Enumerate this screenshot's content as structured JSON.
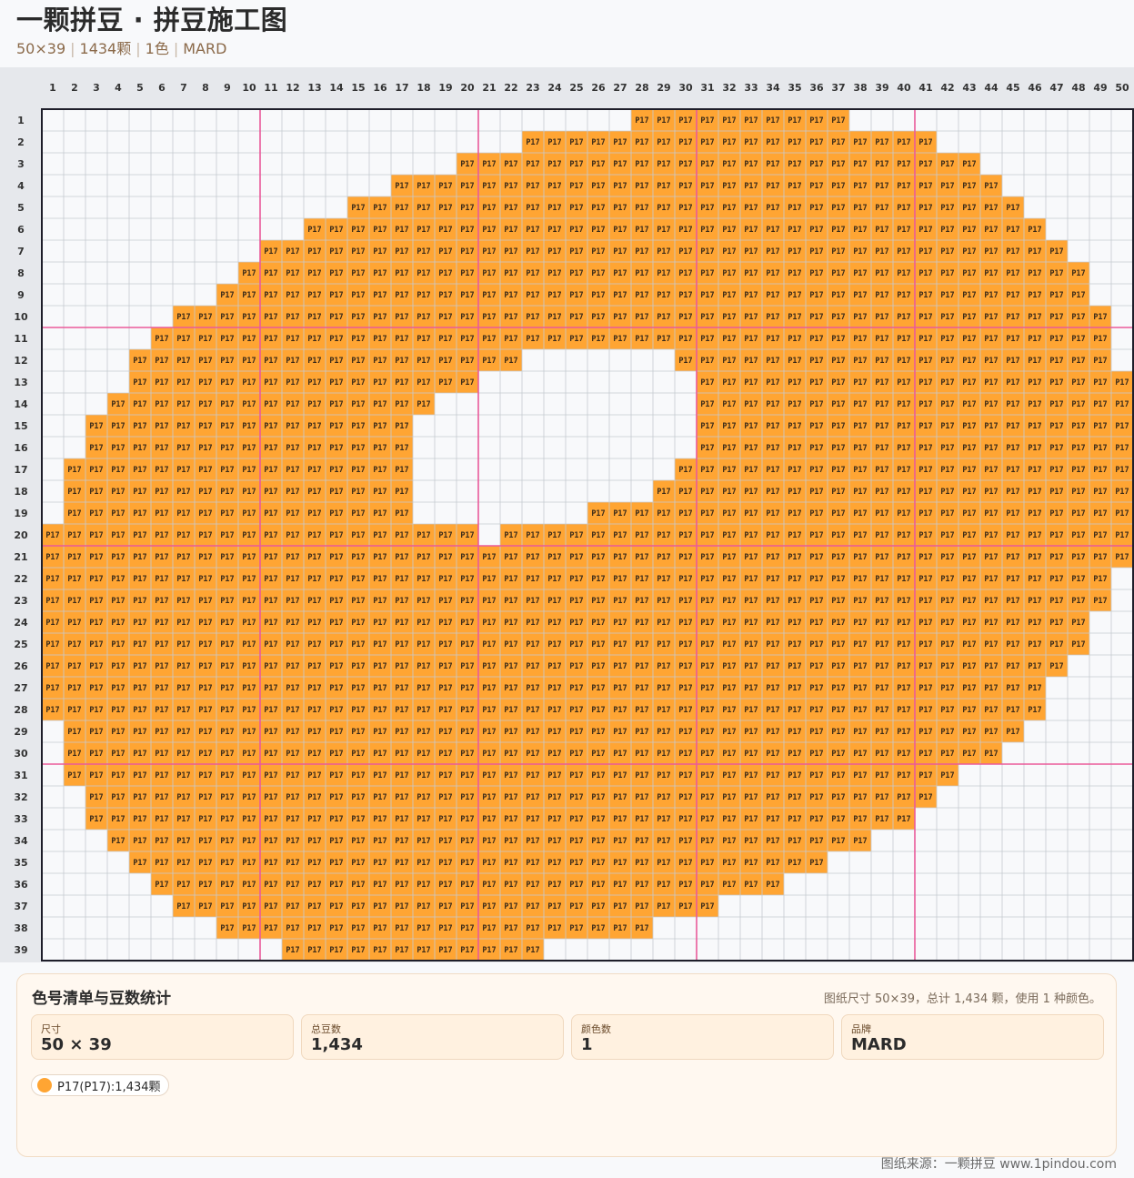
{
  "header": {
    "title": "一颗拼豆 · 拼豆施工图",
    "size": "50×39",
    "count": "1434颗",
    "colors": "1色",
    "brand": "MARD"
  },
  "grid": {
    "columns": 50,
    "rows": 39,
    "bead_code": "P17",
    "bead_color": "#ffa533",
    "empty_color": "#f8f9fb",
    "major_line_color": "#ea5a9a",
    "filled_runs": [
      [
        [
          28,
          37
        ]
      ],
      [
        [
          23,
          41
        ]
      ],
      [
        [
          20,
          43
        ]
      ],
      [
        [
          17,
          44
        ]
      ],
      [
        [
          15,
          45
        ]
      ],
      [
        [
          13,
          46
        ]
      ],
      [
        [
          11,
          47
        ]
      ],
      [
        [
          10,
          48
        ]
      ],
      [
        [
          9,
          48
        ]
      ],
      [
        [
          7,
          49
        ]
      ],
      [
        [
          6,
          49
        ]
      ],
      [
        [
          5,
          22
        ],
        [
          30,
          49
        ]
      ],
      [
        [
          5,
          20
        ],
        [
          31,
          50
        ]
      ],
      [
        [
          4,
          18
        ],
        [
          31,
          50
        ]
      ],
      [
        [
          3,
          17
        ],
        [
          31,
          50
        ]
      ],
      [
        [
          3,
          17
        ],
        [
          31,
          50
        ]
      ],
      [
        [
          2,
          17
        ],
        [
          30,
          50
        ]
      ],
      [
        [
          2,
          17
        ],
        [
          29,
          50
        ]
      ],
      [
        [
          2,
          17
        ],
        [
          26,
          50
        ]
      ],
      [
        [
          1,
          20
        ],
        [
          22,
          50
        ]
      ],
      [
        [
          1,
          50
        ]
      ],
      [
        [
          1,
          49
        ]
      ],
      [
        [
          1,
          49
        ]
      ],
      [
        [
          1,
          48
        ]
      ],
      [
        [
          1,
          48
        ]
      ],
      [
        [
          1,
          47
        ]
      ],
      [
        [
          1,
          46
        ]
      ],
      [
        [
          1,
          46
        ]
      ],
      [
        [
          2,
          45
        ]
      ],
      [
        [
          2,
          44
        ]
      ],
      [
        [
          2,
          42
        ]
      ],
      [
        [
          3,
          41
        ]
      ],
      [
        [
          3,
          40
        ]
      ],
      [
        [
          4,
          38
        ]
      ],
      [
        [
          5,
          36
        ]
      ],
      [
        [
          6,
          34
        ]
      ],
      [
        [
          7,
          31
        ]
      ],
      [
        [
          9,
          28
        ]
      ],
      [
        [
          12,
          23
        ]
      ]
    ]
  },
  "panel": {
    "title": "色号清单与豆数统计",
    "summary": "图纸尺寸 50×39，总计 1,434 颗，使用 1 种颜色。",
    "stats": [
      {
        "label": "尺寸",
        "value": "50 × 39"
      },
      {
        "label": "总豆数",
        "value": "1,434"
      },
      {
        "label": "颜色数",
        "value": "1"
      },
      {
        "label": "品牌",
        "value": "MARD"
      }
    ],
    "legend": [
      {
        "text": "P17(P17):1,434颗",
        "color": "#ffa533"
      }
    ]
  },
  "footer": {
    "source": "图纸来源：一颗拼豆 www.1pindou.com"
  }
}
